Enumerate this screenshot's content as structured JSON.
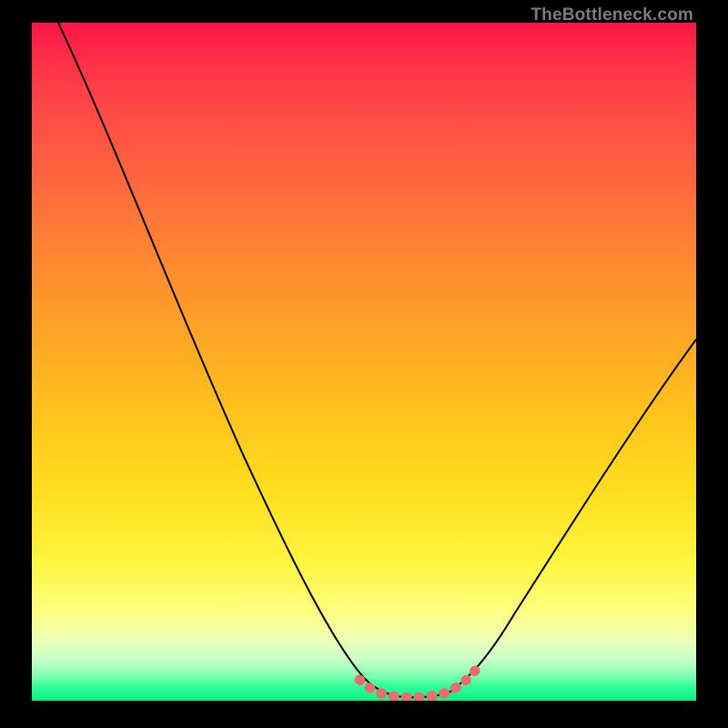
{
  "watermark": "TheBottleneck.com",
  "chart_data": {
    "type": "line",
    "title": "",
    "xlabel": "",
    "ylabel": "",
    "xlim": [
      0,
      100
    ],
    "ylim": [
      0,
      100
    ],
    "series": [
      {
        "name": "bottleneck-curve",
        "x": [
          4,
          10,
          16,
          22,
          28,
          34,
          40,
          46,
          49,
          52,
          55,
          58,
          61,
          64,
          67,
          72,
          78,
          84,
          90,
          96,
          100
        ],
        "y": [
          100,
          87,
          74,
          61,
          48,
          35,
          22,
          9,
          3.5,
          1.2,
          0.6,
          0.5,
          0.5,
          0.8,
          2.5,
          8,
          17,
          27,
          37,
          47,
          53
        ]
      },
      {
        "name": "highlight-segment",
        "x": [
          49,
          52,
          55,
          58,
          61,
          64,
          67
        ],
        "y": [
          3.5,
          1.2,
          0.6,
          0.5,
          0.5,
          0.8,
          2.5
        ]
      }
    ],
    "colors": {
      "curve": "#000000",
      "highlight": "#e86d6d",
      "gradient_top": "#ff1547",
      "gradient_bottom": "#12ee80"
    }
  }
}
